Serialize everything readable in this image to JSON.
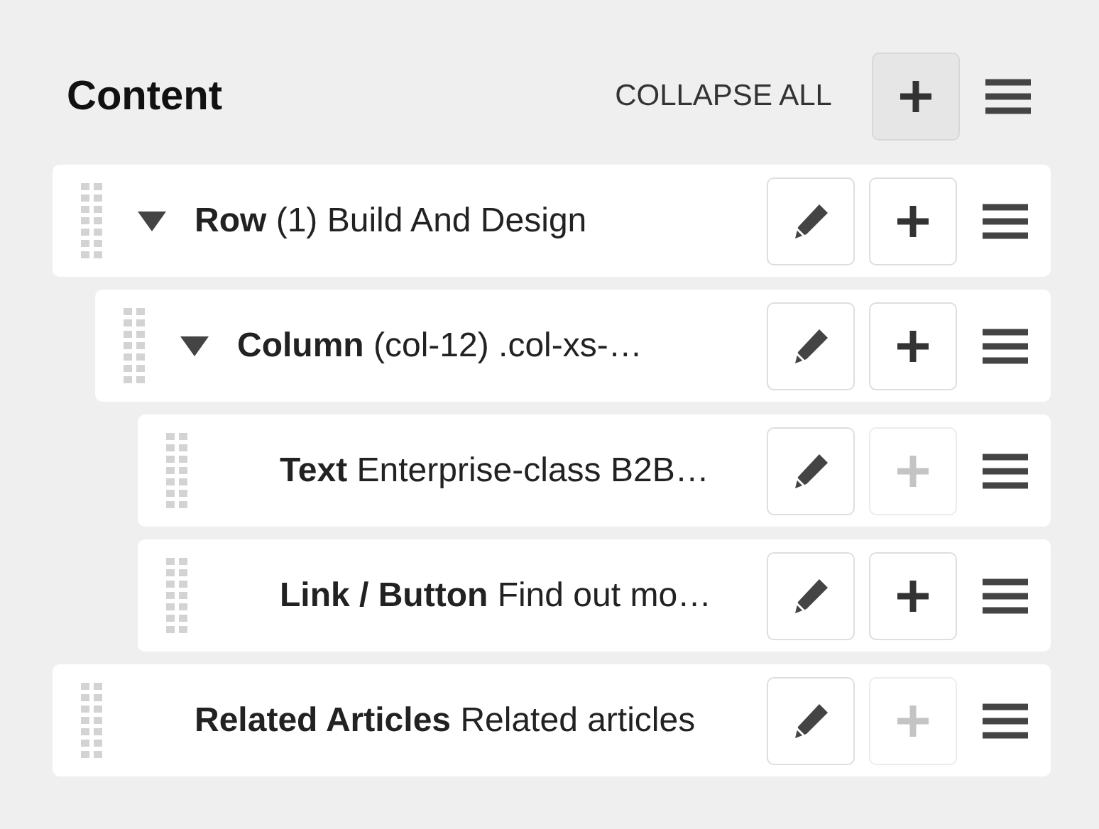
{
  "header": {
    "title": "Content",
    "collapse_all": "COLLAPSE ALL"
  },
  "items": [
    {
      "label": "Row",
      "detail": "(1) Build And Design",
      "expanded": true,
      "add_disabled": false,
      "children": [
        {
          "label": "Column",
          "detail": "(col-12) .col-xs-…",
          "expanded": true,
          "add_disabled": false,
          "children": [
            {
              "label": "Text",
              "detail": "Enterprise-class B2B…",
              "add_disabled": true
            },
            {
              "label": "Link / Button",
              "detail": "Find out mo…",
              "add_disabled": false
            }
          ]
        }
      ]
    },
    {
      "label": "Related Articles",
      "detail": "Related articles",
      "add_disabled": true
    }
  ]
}
